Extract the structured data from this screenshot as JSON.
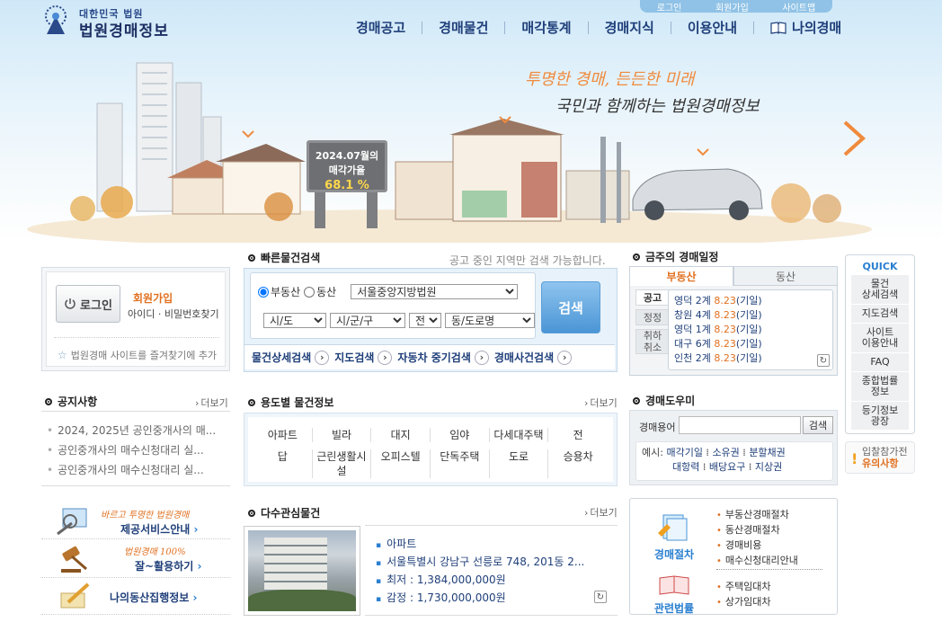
{
  "header": {
    "logo_small": "대한민국 법원",
    "logo_big": "법원경매정보",
    "util_links": [
      "로그인",
      "회원가입",
      "사이트맵"
    ],
    "nav": [
      "경매공고",
      "경매물건",
      "매각통계",
      "경매지식",
      "이용안내"
    ],
    "nav_mypage": "나의경매",
    "slogan_1": "투명한 경매, 든든한 미래",
    "slogan_2": "국민과 함께하는 법원경매정보",
    "sign_line1": "2024.07월의",
    "sign_line2": "매각가율",
    "sign_value": "68.1 %"
  },
  "login": {
    "button": "로그인",
    "join": "회원가입",
    "find": "아이디 · 비밀번호찾기",
    "favorite": "법원경매 사이트를 즐겨찾기에 추가"
  },
  "quick_search": {
    "title": "빠른물건검색",
    "note": "공고 중인 지역만 검색 가능합니다.",
    "radio_realestate": "부동산",
    "radio_movable": "동산",
    "court": "서울중앙지방법원",
    "sido": "시/도",
    "sigungu": "시/군/구",
    "all": "전",
    "road": "동/도로명",
    "search_button": "검색",
    "links": [
      "물건상세검색",
      "지도검색",
      "자동차 중기검색",
      "경매사건검색"
    ]
  },
  "schedule": {
    "title": "금주의 경매일정",
    "tab_on": "부동산",
    "tab_off": "동산",
    "side_tags": [
      "공고",
      "정정",
      "취하\n취소"
    ],
    "items": [
      {
        "court": "영덕 2계",
        "date": "8.23",
        "kind": "(기일)"
      },
      {
        "court": "창원 4계",
        "date": "8.23",
        "kind": "(기일)"
      },
      {
        "court": "영덕 1계",
        "date": "8.23",
        "kind": "(기일)"
      },
      {
        "court": "대구 6계",
        "date": "8.23",
        "kind": "(기일)"
      },
      {
        "court": "인천 2계",
        "date": "8.23",
        "kind": "(기일)"
      }
    ]
  },
  "quick": {
    "title": "QUICK",
    "items": [
      "물건\n상세검색",
      "지도검색",
      "사이트\n이용안내",
      "FAQ",
      "종합법률\n정보",
      "등기정보\n광장"
    ],
    "caution_1": "입찰참가전",
    "caution_2": "유의사항"
  },
  "notice": {
    "title": "공지사항",
    "more": "더보기",
    "items": [
      "2024, 2025년 공인중개사의 매...",
      "공인중개사의 매수신청대리 실...",
      "공인중개사의 매수신청대리 실..."
    ]
  },
  "use_type": {
    "title": "용도별 물건정보",
    "more": "더보기",
    "items": [
      "아파트",
      "빌라",
      "대지",
      "임야",
      "다세대주택",
      "전",
      "답",
      "근린생활시설",
      "오피스텔",
      "단독주택",
      "도로",
      "승용차"
    ]
  },
  "dictionary": {
    "title": "경매도우미",
    "label": "경매용어",
    "button": "검색",
    "example_label": "예시:",
    "examples": [
      "매각기일",
      "소유권",
      "분할채권",
      "대항력",
      "배당요구",
      "지상권"
    ]
  },
  "promo": [
    {
      "script": "바르고 투명한 법원경매",
      "main": "제공서비스안내"
    },
    {
      "script": "법원경매 100%",
      "main": "잘~활용하기"
    },
    {
      "script": "",
      "main": "나의동산집행정보"
    }
  ],
  "popular": {
    "title": "다수관심물건",
    "more": "더보기",
    "type": "아파트",
    "address": "서울특별시 강남구 선릉로 748, 201동 2...",
    "min_price": "최저 : 1,384,000,000원",
    "appraisal": "감정 : 1,730,000,000원"
  },
  "procedure": {
    "label_1": "경매절차",
    "items_1": [
      "부동산경매절차",
      "동산경매절차",
      "경매비용",
      "매수신청대리안내"
    ],
    "label_2": "관련법률",
    "items_2": [
      "주택임대차",
      "상가임대차"
    ]
  }
}
